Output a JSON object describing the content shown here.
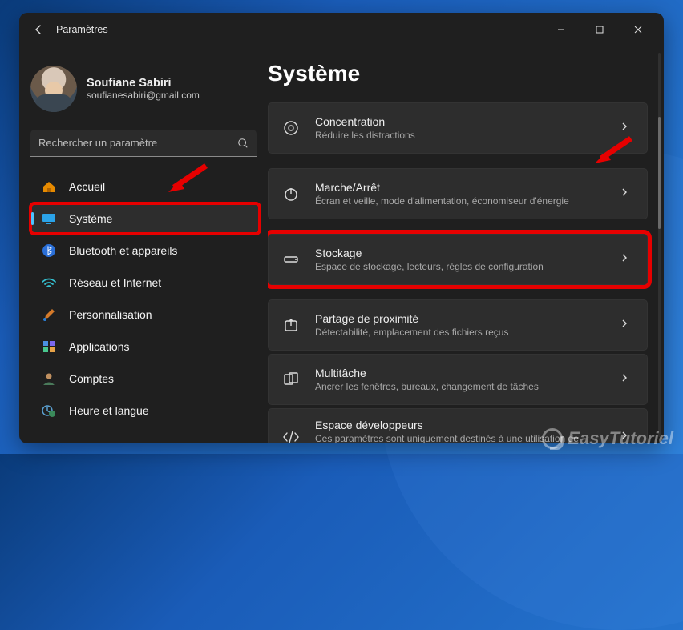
{
  "window": {
    "app_title": "Paramètres"
  },
  "profile": {
    "name": "Soufiane Sabiri",
    "email": "soufianesabiri@gmail.com"
  },
  "search": {
    "placeholder": "Rechercher un paramètre"
  },
  "sidebar": {
    "items": [
      {
        "label": "Accueil",
        "icon": "home-icon"
      },
      {
        "label": "Système",
        "icon": "monitor-icon",
        "selected": true,
        "highlight": true
      },
      {
        "label": "Bluetooth et appareils",
        "icon": "bluetooth-icon"
      },
      {
        "label": "Réseau et Internet",
        "icon": "wifi-icon"
      },
      {
        "label": "Personnalisation",
        "icon": "brush-icon"
      },
      {
        "label": "Applications",
        "icon": "apps-icon"
      },
      {
        "label": "Comptes",
        "icon": "person-icon"
      },
      {
        "label": "Heure et langue",
        "icon": "clock-globe-icon"
      }
    ]
  },
  "main": {
    "title": "Système",
    "cards": [
      {
        "icon": "concentration-icon",
        "title": "Concentration",
        "subtitle": "Réduire les distractions"
      },
      {
        "icon": "power-icon",
        "title": "Marche/Arrêt",
        "subtitle": "Écran et veille, mode d'alimentation, économiseur d'énergie"
      },
      {
        "icon": "storage-icon",
        "title": "Stockage",
        "subtitle": "Espace de stockage, lecteurs, règles de configuration",
        "highlight": true
      },
      {
        "icon": "share-icon",
        "title": "Partage de proximité",
        "subtitle": "Détectabilité, emplacement des fichiers reçus"
      },
      {
        "icon": "multitask-icon",
        "title": "Multitâche",
        "subtitle": "Ancrer les fenêtres, bureaux, changement de tâches"
      },
      {
        "icon": "devspace-icon",
        "title": "Espace développeurs",
        "subtitle": "Ces paramètres sont uniquement destinés à une utilisation de développement",
        "tall": true
      }
    ]
  },
  "annotations": {
    "arrow_sidebar": true,
    "arrow_main": true,
    "highlight_color": "#e60000"
  },
  "watermark": "EasyTutoriel"
}
